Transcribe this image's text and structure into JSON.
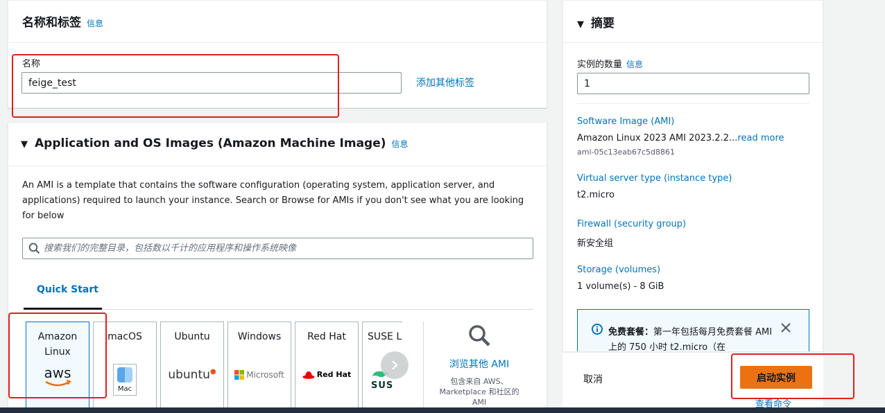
{
  "name_tags": {
    "title": "名称和标签",
    "info": "信息",
    "name_label": "名称",
    "name_value": "feige_test",
    "add_tags": "添加其他标签"
  },
  "ami": {
    "title": "Application and OS Images (Amazon Machine Image)",
    "info": "信息",
    "description": "An AMI is a template that contains the software configuration (operating system, application server, and applications) required to launch your instance. Search or Browse for AMIs if you don't see what you are looking for below",
    "search_placeholder": "搜索我们的完整目录，包括数以千计的应用程序和操作系统映像",
    "tab_quick_start": "Quick Start",
    "os_options": [
      {
        "name": "Amazon Linux",
        "selected": true
      },
      {
        "name": "macOS",
        "logo_text": "Mac"
      },
      {
        "name": "Ubuntu",
        "logo_text": "ubuntu"
      },
      {
        "name": "Windows",
        "logo_text": "Microsoft"
      },
      {
        "name": "Red Hat",
        "logo_text": "Red Hat"
      },
      {
        "name": "SUSE Li",
        "logo_text": "SUS"
      }
    ],
    "aws_logo_text": "aws",
    "browse_more": "浏览其他 AMI",
    "browse_desc": "包含来自 AWS、Marketplace 和社区的 AMI"
  },
  "summary": {
    "title": "摘要",
    "instance_count_label": "实例的数量",
    "info": "信息",
    "instance_count": "1",
    "software_image_label": "Software Image (AMI)",
    "software_image_value": "Amazon Linux 2023 AMI 2023.2.2...",
    "read_more": "read more",
    "ami_id": "ami-05c13eab67c5d8861",
    "instance_type_label": "Virtual server type (instance type)",
    "instance_type_value": "t2.micro",
    "firewall_label": "Firewall (security group)",
    "firewall_value": "新安全组",
    "storage_label": "Storage (volumes)",
    "storage_value": "1 volume(s) - 8 GiB",
    "free_tier_bold": "免费套餐：",
    "free_tier_text": "第一年包括每月免费套餐 AMI 上的 750 小时 t2.micro（在"
  },
  "actions": {
    "cancel": "取消",
    "launch": "启动实例",
    "view_command": "查看命令"
  },
  "colors": {
    "accent": "#0073bb",
    "primary_button": "#ec7211",
    "annotation": "#e01e1e"
  }
}
